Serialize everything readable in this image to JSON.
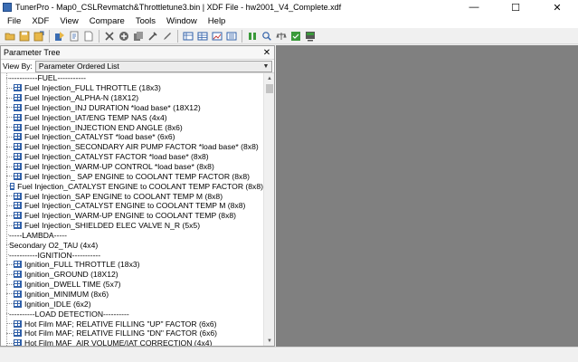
{
  "window": {
    "title": "TunerPro - Map0_CSLRevmatch&Throttletune3.bin | XDF File - hw2001_V4_Complete.xdf",
    "minimize": "—",
    "maximize": "☐",
    "close": "✕"
  },
  "menu": [
    "File",
    "XDF",
    "View",
    "Compare",
    "Tools",
    "Window",
    "Help"
  ],
  "toolbar": {
    "buttons": [
      "open-icon",
      "save-icon",
      "save-as-icon",
      "load-bin-icon",
      "xdf-icon",
      "new-icon",
      "close-icon",
      "add-icon",
      "copy-icon",
      "tool-icon",
      "edit-icon",
      "table-icon",
      "grid-icon",
      "chart-icon",
      "list-icon",
      "compare-icon",
      "search-icon",
      "scale-icon",
      "checksum-icon",
      "monitor-icon"
    ]
  },
  "panel": {
    "title": "Parameter Tree",
    "close": "✕",
    "viewby_label": "View By:",
    "viewby_value": "Parameter Ordered List",
    "items": [
      {
        "label": "-----------FUEL-----------",
        "icon": false
      },
      {
        "label": "Fuel Injection_FULL THROTTLE (18x3)",
        "icon": true
      },
      {
        "label": "Fuel Injection_ALPHA-N (18X12)",
        "icon": true
      },
      {
        "label": "Fuel Injection_INJ DURATION *load base* (18X12)",
        "icon": true
      },
      {
        "label": "Fuel Injection_IAT/ENG TEMP NAS (4x4)",
        "icon": true
      },
      {
        "label": "Fuel Injection_INJECTION END ANGLE (8x6)",
        "icon": true
      },
      {
        "label": "Fuel Injection_CATALYST *load base* (6x6)",
        "icon": true
      },
      {
        "label": "Fuel Injection_SECONDARY AIR PUMP FACTOR *load base* (8x8)",
        "icon": true
      },
      {
        "label": "Fuel Injection_CATALYST FACTOR *load base* (8x8)",
        "icon": true
      },
      {
        "label": "Fuel Injection_WARM-UP CONTROL *load base* (8x8)",
        "icon": true
      },
      {
        "label": "Fuel Injection_ SAP ENGINE to COOLANT TEMP FACTOR (8x8)",
        "icon": true
      },
      {
        "label": "Fuel Injection_CATALYST ENGINE to COOLANT TEMP FACTOR (8x8)",
        "icon": true
      },
      {
        "label": "Fuel Injection_SAP ENGINE to COOLANT TEMP M (8x8)",
        "icon": true
      },
      {
        "label": "Fuel Injection_CATALYST  ENGINE to COOLANT TEMP M (8x8)",
        "icon": true
      },
      {
        "label": "Fuel Injection_WARM-UP ENGINE to COOLANT TEMP (8x8)",
        "icon": true
      },
      {
        "label": "Fuel Injection_SHIELDED ELEC VALVE N_R (5x5)",
        "icon": true
      },
      {
        "label": "-----LAMBDA-----",
        "icon": false
      },
      {
        "label": "Secondary O2_TAU (4x4)",
        "icon": false
      },
      {
        "label": "-----------IGNITION-----------",
        "icon": false
      },
      {
        "label": "Ignition_FULL THROTTLE (18x3)",
        "icon": true
      },
      {
        "label": "Ignition_GROUND (18X12)",
        "icon": true
      },
      {
        "label": "Ignition_DWELL TIME (5x7)",
        "icon": true
      },
      {
        "label": "Ignition_MINIMUM (8x6)",
        "icon": true
      },
      {
        "label": "Ignition_IDLE (6x2)",
        "icon": true
      },
      {
        "label": "----------LOAD DETECTION----------",
        "icon": false
      },
      {
        "label": "Hot Film MAF; RELATIVE FILLING \"UP\" FACTOR (6x6)",
        "icon": true
      },
      {
        "label": "Hot Film MAF; RELATIVE FILLING \"DN\" FACTOR (6x6)",
        "icon": true
      },
      {
        "label": "Hot Film MAF_AIR VOLUME/IAT CORRECTION (4x4)",
        "icon": true
      }
    ]
  },
  "scrollbar": {
    "up": "▲",
    "down": "▼"
  },
  "colors": {
    "workarea": "#808080",
    "panel_bg": "#ffffff",
    "icon_blue": "#2f5fa8"
  }
}
